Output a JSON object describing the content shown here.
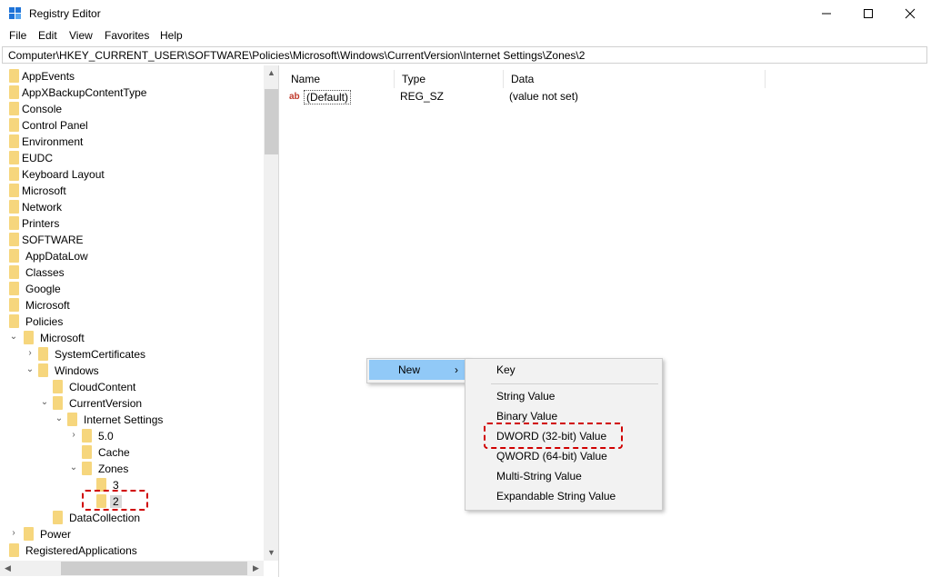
{
  "window": {
    "title": "Registry Editor",
    "minimize_icon": "minimize-icon",
    "maximize_icon": "maximize-icon",
    "close_icon": "close-icon"
  },
  "menu": [
    "File",
    "Edit",
    "View",
    "Favorites",
    "Help"
  ],
  "address": "Computer\\HKEY_CURRENT_USER\\SOFTWARE\\Policies\\Microsoft\\Windows\\CurrentVersion\\Internet Settings\\Zones\\2",
  "tree": [
    {
      "label": "AppEvents"
    },
    {
      "label": "AppXBackupContentType"
    },
    {
      "label": "Console"
    },
    {
      "label": "Control Panel"
    },
    {
      "label": "Environment"
    },
    {
      "label": "EUDC"
    },
    {
      "label": "Keyboard Layout"
    },
    {
      "label": "Microsoft"
    },
    {
      "label": "Network"
    },
    {
      "label": "Printers"
    },
    {
      "label": "SOFTWARE"
    },
    {
      "label": "AppDataLow"
    },
    {
      "label": "Classes"
    },
    {
      "label": "Google"
    },
    {
      "label": "Microsoft"
    },
    {
      "label": "Policies"
    },
    {
      "label": "Microsoft"
    },
    {
      "label": "SystemCertificates"
    },
    {
      "label": "Windows"
    },
    {
      "label": "CloudContent"
    },
    {
      "label": "CurrentVersion"
    },
    {
      "label": "Internet Settings"
    },
    {
      "label": "5.0"
    },
    {
      "label": "Cache"
    },
    {
      "label": "Zones"
    },
    {
      "label": "3"
    },
    {
      "label": "2"
    },
    {
      "label": "DataCollection"
    },
    {
      "label": "Power"
    },
    {
      "label": "RegisteredApplications"
    }
  ],
  "list": {
    "headers": {
      "name": "Name",
      "type": "Type",
      "data": "Data"
    },
    "rows": [
      {
        "name": "(Default)",
        "type": "REG_SZ",
        "data": "(value not set)",
        "icon": "string-value-icon"
      }
    ]
  },
  "context_menu": {
    "parent": {
      "label": "New",
      "arrow": "›"
    },
    "submenu": [
      "Key",
      "String Value",
      "Binary Value",
      "DWORD (32-bit) Value",
      "QWORD (64-bit) Value",
      "Multi-String Value",
      "Expandable String Value"
    ]
  },
  "colors": {
    "folder": "#f6d67d",
    "menu_highlight": "#91c9f7",
    "annotation": "#d00000",
    "selection": "#d9d9d9"
  }
}
